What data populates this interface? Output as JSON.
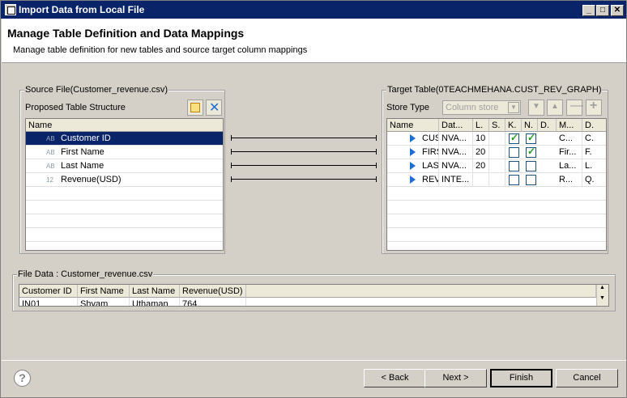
{
  "window": {
    "title": "Import Data from Local File"
  },
  "header": {
    "title": "Manage Table Definition and Data Mappings",
    "subtitle": "Manage table definition for new tables and source target column mappings"
  },
  "source": {
    "group_label": "Source File(Customer_revenue.csv)",
    "proposed_label": "Proposed Table Structure",
    "column_header": "Name",
    "rows": [
      {
        "type": "AB",
        "name": "Customer ID"
      },
      {
        "type": "AB",
        "name": "First Name"
      },
      {
        "type": "AB",
        "name": "Last Name"
      },
      {
        "type": "12",
        "name": "Revenue(USD)"
      }
    ]
  },
  "target": {
    "group_label": "Target Table(0TEACHMEHANA.CUST_REV_GRAPH)",
    "store_type_label": "Store Type",
    "store_type_value": "Column store",
    "headers": [
      "Name",
      "Dat...",
      "L.",
      "S.",
      "K.",
      "N.",
      "D.",
      "M...",
      "D."
    ],
    "rows": [
      {
        "name": "CUS",
        "dtype": "NVA...",
        "len": "10",
        "scale": "",
        "key": true,
        "notnull": true,
        "d": "",
        "m": "C...",
        "d2": "C."
      },
      {
        "name": "FIRS",
        "dtype": "NVA...",
        "len": "20",
        "scale": "",
        "key": false,
        "notnull": true,
        "d": "",
        "m": "Fir...",
        "d2": "F."
      },
      {
        "name": "LAS",
        "dtype": "NVA...",
        "len": "20",
        "scale": "",
        "key": false,
        "notnull": false,
        "d": "",
        "m": "La...",
        "d2": "L."
      },
      {
        "name": "REV",
        "dtype": "INTE...",
        "len": "",
        "scale": "",
        "key": false,
        "notnull": false,
        "d": "",
        "m": "R...",
        "d2": "Q."
      }
    ]
  },
  "file_data": {
    "group_label": "File Data : Customer_revenue.csv",
    "headers": [
      "Customer ID",
      "First Name",
      "Last Name",
      "Revenue(USD)"
    ],
    "rows": [
      [
        "IN01",
        "Shyam",
        "Uthaman",
        "764"
      ]
    ]
  },
  "buttons": {
    "back": "< Back",
    "next": "Next >",
    "finish": "Finish",
    "cancel": "Cancel",
    "help": "?"
  }
}
